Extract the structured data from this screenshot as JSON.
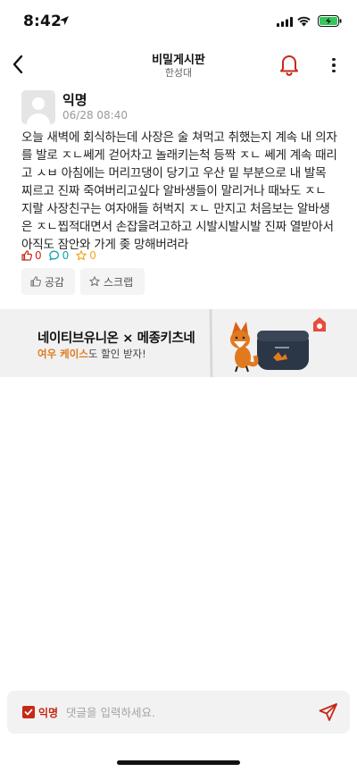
{
  "status_bar": {
    "time": "8:42"
  },
  "header": {
    "title": "비밀게시판",
    "subtitle": "한성대"
  },
  "post": {
    "author": "익명",
    "date": "06/28 08:40",
    "body": "오늘 새벽에 회식하는데 사장은 술 쳐먹고 취했는지 계속 내 의자를 발로 ㅈㄴ쎄게 걷어차고 놀래키는척 등짝 ㅈㄴ 쎄게 계속 때리고 ㅅㅂ 아침에는 머리끄댕이 당기고 우산 밑 부분으로 내 발목 찌르고 진짜 죽여버리고싶다 알바생들이 말리거나 때놔도 ㅈㄴ 지랄 사장친구는 여자애들 허벅지 ㅈㄴ 만지고 처음보는 알바생은 ㅈㄴ찝적대면서 손잡을려고하고 시발시발시발 진짜 열받아서 아직도 잠안와 가게 좆 망해버려라",
    "counts": {
      "likes": "0",
      "comments": "0",
      "scraps": "0"
    },
    "actions": {
      "like_label": "공감",
      "scrap_label": "스크랩"
    }
  },
  "ad": {
    "title": "네이티브유니온 × 메종키츠네",
    "subtitle_highlight": "여우 케이스",
    "subtitle_rest": "도 할인 받자!"
  },
  "comment_bar": {
    "anon_label": "익명",
    "placeholder": "댓글을 입력하세요."
  },
  "colors": {
    "accent_red": "#c62917",
    "comment_teal": "#0ca5af",
    "scrap_yellow": "#f5a623"
  }
}
